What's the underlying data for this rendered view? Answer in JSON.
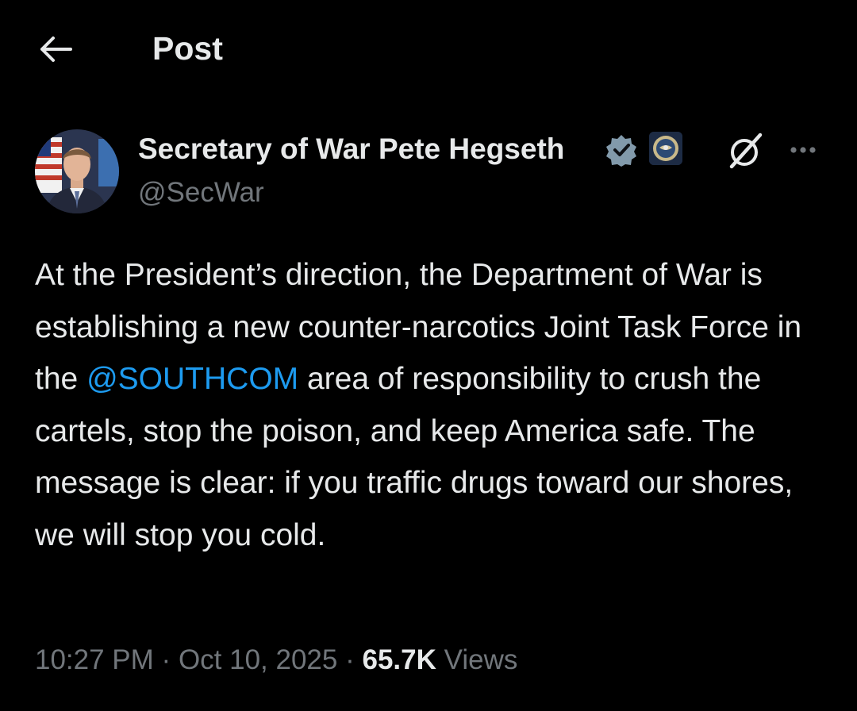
{
  "header": {
    "title": "Post",
    "back_icon": "back-arrow-icon"
  },
  "author": {
    "display_name": "Secretary of War Pete Hegseth",
    "handle": "@SecWar",
    "verified_icon": "verified-badge-icon",
    "affiliation_icon": "department-seal-icon",
    "grok_icon": "grok-icon",
    "more_icon": "more-options-icon"
  },
  "post": {
    "text_before_mention": "At the President’s direction, the Department of War is establishing a new counter-narcotics Joint Task Force in the ",
    "mention": "@SOUTHCOM",
    "text_after_mention": " area of responsibility to crush the cartels, stop the poison, and keep America safe. The message is clear: if you traffic drugs toward our shores, we will stop you cold."
  },
  "meta": {
    "time": "10:27 PM",
    "separator": "·",
    "date": "Oct 10, 2025",
    "views_count": "65.7K",
    "views_label": "Views"
  },
  "colors": {
    "background": "#000000",
    "text_primary": "#e7e9ea",
    "text_secondary": "#71767b",
    "link": "#1d9bf0",
    "verified": "#829aab"
  }
}
